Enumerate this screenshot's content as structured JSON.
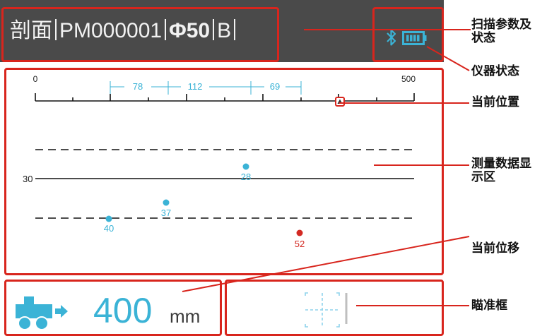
{
  "header": {
    "mode": "剖面",
    "project_id": "PM000001",
    "diameter": "Φ50",
    "channel": "B"
  },
  "scale": {
    "start": "0",
    "end": "500",
    "segments": [
      "78",
      "112",
      "69"
    ]
  },
  "measurements": {
    "reference_value": "30",
    "points": [
      {
        "label": "28",
        "status": "normal"
      },
      {
        "label": "37",
        "status": "normal"
      },
      {
        "label": "40",
        "status": "normal"
      },
      {
        "label": "52",
        "status": "alert"
      }
    ]
  },
  "displacement": {
    "value": "400",
    "unit": "mm"
  },
  "annotations": {
    "scan_params": "扫描参数及\n状态",
    "instrument_status": "仪器状态",
    "current_position": "当前位置",
    "data_area": "测量数据显\n示区",
    "current_displacement": "当前位移",
    "aiming_frame": "瞄准框"
  },
  "colors": {
    "accent_blue": "#3bb3d6",
    "alert_red": "#d32a23",
    "annotation_red": "#d8251d",
    "panel_dark": "#4a4a4a"
  },
  "icons": {
    "bluetooth": "bluetooth-icon",
    "battery": "battery-icon",
    "position_marker": "position-marker-icon",
    "cart": "cart-icon",
    "crosshair": "crosshair-icon"
  }
}
